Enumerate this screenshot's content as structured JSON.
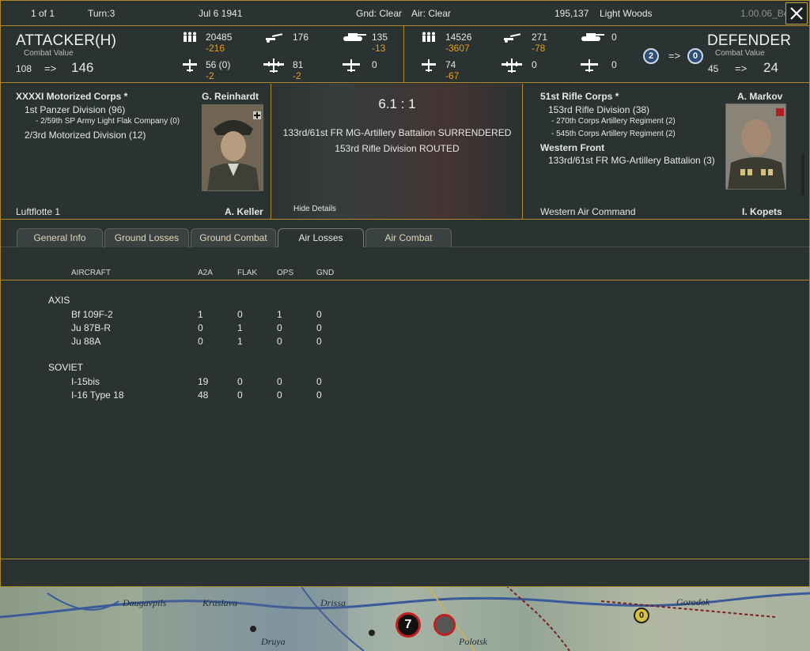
{
  "topbar": {
    "page": "1 of 1",
    "turn": "Turn:3",
    "date": "Jul 6 1941",
    "ground": "Gnd: Clear",
    "air": "Air: Clear",
    "hex_id": "195,137",
    "terrain": "Light Woods",
    "version": "1.00.06_Be"
  },
  "attacker": {
    "title": "ATTACKER(H)",
    "cv_label": "Combat Value",
    "cv_from": "108",
    "arrow": "=>",
    "cv_to": "146",
    "men": "20485",
    "men_loss": "-216",
    "guns": "176",
    "tanks": "135",
    "tanks_loss": "-13",
    "fighters": "56 (0)",
    "fighters_loss": "-2",
    "bombers": "81",
    "bombers_loss": "-2",
    "transports": "0"
  },
  "defender": {
    "title": "DEFENDER",
    "cv_label": "Combat Value",
    "cv_from": "45",
    "arrow": "=>",
    "cv_to": "24",
    "men": "14526",
    "men_loss": "-3607",
    "guns": "271",
    "guns_loss": "-78",
    "tanks": "0",
    "fighters": "74",
    "fighters_loss": "-67",
    "bombers": "0",
    "transports": "0",
    "fort_from": "2",
    "fort_arrow": "=>",
    "fort_to": "0"
  },
  "attacker_units": {
    "hq": "XXXXI Motorized Corps *",
    "commander": "G. Reinhardt",
    "lines": [
      "1st Panzer Division (96)",
      "- 2/59th SP Army Light Flak Company (0)",
      "2/3rd Motorized Division (12)"
    ],
    "cut_left": "Luftflotte 1",
    "cut_right": "A. Keller"
  },
  "defender_units": {
    "hq": "51st Rifle Corps *",
    "commander": "A. Markov",
    "lines": [
      "153rd Rifle Division (38)",
      "- 270th Corps Artillery Regiment (2)",
      "- 545th Corps Artillery Regiment (2)"
    ],
    "hq2": "Western Front",
    "line2": "133rd/61st FR MG-Artillery Battalion (3)",
    "cut_left": "Western Air Command",
    "cut_right": "I. Kopets"
  },
  "result": {
    "ratio": "6.1 : 1",
    "line1": "133rd/61st FR MG-Artillery Battalion SURRENDERED",
    "line2": "153rd Rifle Division ROUTED",
    "hide_details": "Hide Details"
  },
  "tabs": [
    {
      "label": "General Info",
      "active": false
    },
    {
      "label": "Ground Losses",
      "active": false
    },
    {
      "label": "Ground Combat",
      "active": false
    },
    {
      "label": "Air Losses",
      "active": true
    },
    {
      "label": "Air Combat",
      "active": false
    }
  ],
  "table": {
    "headers": [
      "AIRCRAFT",
      "A2A",
      "FLAK",
      "OPS",
      "GND"
    ],
    "groups": [
      {
        "name": "AXIS",
        "rows": [
          [
            "Bf 109F-2",
            "1",
            "0",
            "1",
            "0"
          ],
          [
            "Ju 87B-R",
            "0",
            "1",
            "0",
            "0"
          ],
          [
            "Ju 88A",
            "0",
            "1",
            "0",
            "0"
          ]
        ]
      },
      {
        "name": "SOVIET",
        "rows": [
          [
            "I-15bis",
            "19",
            "0",
            "0",
            "0"
          ],
          [
            "I-16 Type 18",
            "48",
            "0",
            "0",
            "0"
          ]
        ]
      }
    ]
  },
  "map": {
    "labels": [
      "Daugavpils",
      "Kraslava",
      "Drissa",
      "Druya",
      "Polotsk",
      "Gorodok"
    ],
    "counters": [
      "7",
      "0"
    ]
  },
  "colors": {
    "border": "#b08a2a",
    "loss": "#e8a020",
    "background": "#2b3232"
  }
}
